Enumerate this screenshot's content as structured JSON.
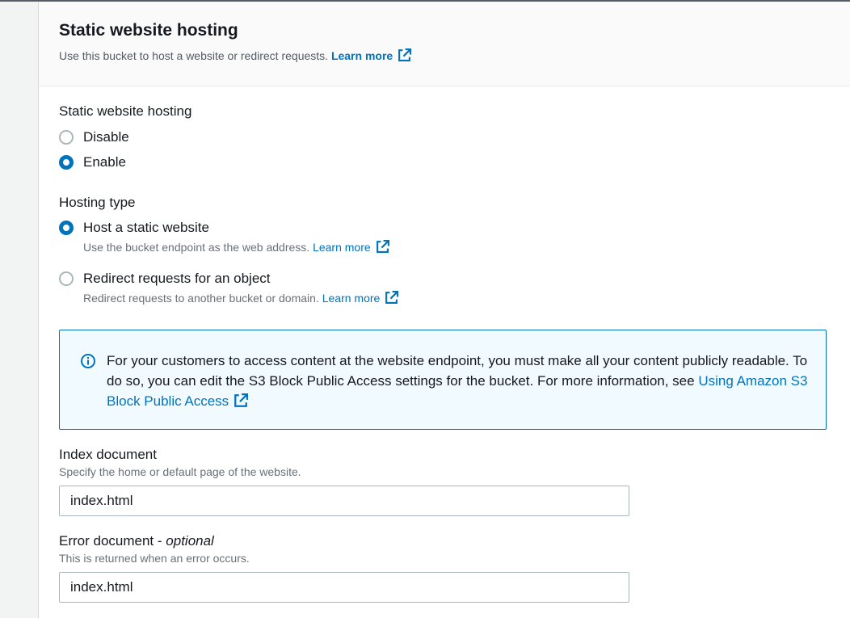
{
  "section": {
    "title": "Static website hosting",
    "description": "Use this bucket to host a website or redirect requests.",
    "learn_more": "Learn more"
  },
  "hosting": {
    "label": "Static website hosting",
    "options": [
      {
        "label": "Disable",
        "checked": false
      },
      {
        "label": "Enable",
        "checked": true
      }
    ]
  },
  "hosting_type": {
    "label": "Hosting type",
    "options": [
      {
        "label": "Host a static website",
        "description": "Use the bucket endpoint as the web address.",
        "learn_more": "Learn more",
        "checked": true
      },
      {
        "label": "Redirect requests for an object",
        "description": "Redirect requests to another bucket or domain.",
        "learn_more": "Learn more",
        "checked": false
      }
    ]
  },
  "info_alert": {
    "text": "For your customers to access content at the website endpoint, you must make all your content publicly readable. To do so, you can edit the S3 Block Public Access settings for the bucket. For more information, see",
    "link": "Using Amazon S3 Block Public Access",
    "icon": "info-icon"
  },
  "index_document": {
    "label": "Index document",
    "description": "Specify the home or default page of the website.",
    "value": "index.html"
  },
  "error_document": {
    "label": "Error document -",
    "optional": "optional",
    "description": "This is returned when an error occurs.",
    "value": "index.html"
  },
  "colors": {
    "link": "#0073bb",
    "info_bg": "#f1faff",
    "info_border": "#0073bb"
  }
}
